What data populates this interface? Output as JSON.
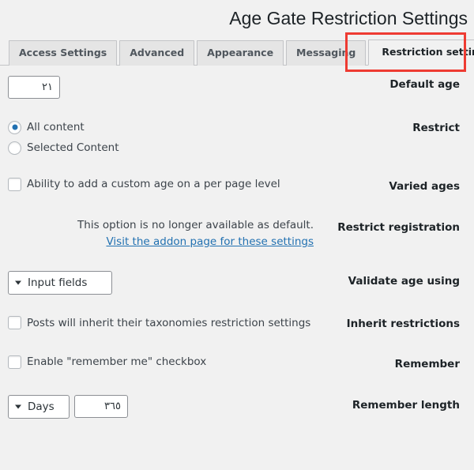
{
  "page": {
    "title": "Age Gate Restriction Settings",
    "direction": "rtl",
    "accent_color": "#2271b1",
    "annotation_color": "#ee3b32",
    "background_color": "#f1f1f1"
  },
  "tabs": [
    {
      "label": "Access Settings",
      "active": false
    },
    {
      "label": "Advanced",
      "active": false
    },
    {
      "label": "Appearance",
      "active": false
    },
    {
      "label": "Messaging",
      "active": false
    },
    {
      "label": "Restriction settings",
      "active": true
    }
  ],
  "settings": {
    "default_age": {
      "label": "Default age",
      "value": "٢١"
    },
    "restrict": {
      "label": "Restrict",
      "options": [
        {
          "label": "All content",
          "selected": true
        },
        {
          "label": "Selected Content",
          "selected": false
        }
      ]
    },
    "varied_ages": {
      "label": "Varied ages",
      "checkbox_label": "Ability to add a custom age on a per page level",
      "checked": false
    },
    "restrict_registration": {
      "label": "Restrict registration",
      "note": ".This option is no longer available as default",
      "link_text": "Visit the addon page for these settings"
    },
    "validate_age_using": {
      "label": "Validate age using",
      "value": "Input fields"
    },
    "inherit_restrictions": {
      "label": "Inherit restrictions",
      "checkbox_label": "Posts will inherit their taxonomies restriction settings",
      "checked": false
    },
    "remember": {
      "label": "Remember",
      "checkbox_label": "Enable \"remember me\" checkbox",
      "checked": false
    },
    "remember_length": {
      "label": "Remember length",
      "unit_value": "Days",
      "amount_value": "٣٦٥"
    }
  }
}
